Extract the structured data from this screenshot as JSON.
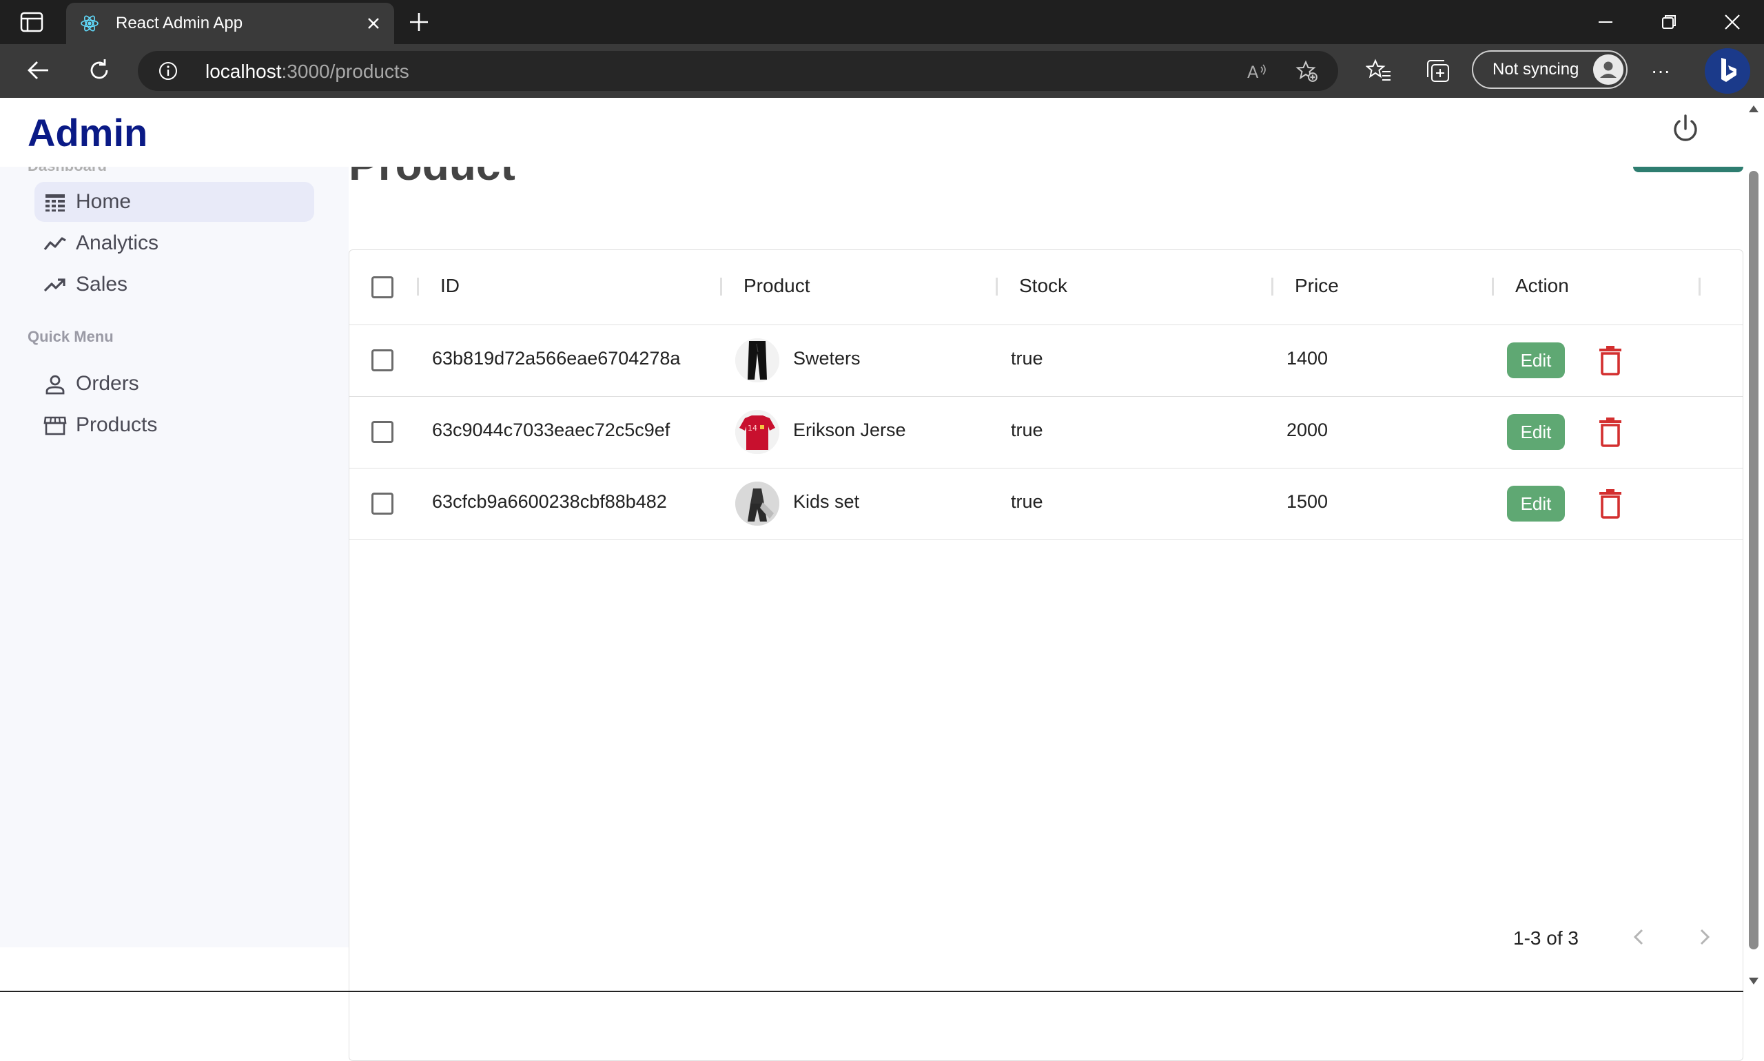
{
  "browser": {
    "tab_title": "React Admin App",
    "url_host": "localhost",
    "url_path": ":3000/products",
    "sync_label": "Not syncing",
    "more_label": "···"
  },
  "header": {
    "logo": "Admin"
  },
  "sidebar": {
    "section_dashboard": "Dashboard",
    "items": [
      {
        "label": "Home",
        "icon": "home-icon",
        "active": true
      },
      {
        "label": "Analytics",
        "icon": "timeline-icon",
        "active": false
      },
      {
        "label": "Sales",
        "icon": "trending-up-icon",
        "active": false
      }
    ],
    "section_quick": "Quick Menu",
    "quick_items": [
      {
        "label": "Orders",
        "icon": "person-icon"
      },
      {
        "label": "Products",
        "icon": "storefront-icon"
      }
    ]
  },
  "main": {
    "heading": "Product"
  },
  "table": {
    "columns": [
      "ID",
      "Product",
      "Stock",
      "Price",
      "Action"
    ],
    "rows": [
      {
        "id": "63b819d72a566eae6704278a",
        "product": "Sweters",
        "stock": "true",
        "price": "1400",
        "edit_label": "Edit"
      },
      {
        "id": "63c9044c7033eaec72c5c9ef",
        "product": "Erikson Jerse",
        "stock": "true",
        "price": "2000",
        "edit_label": "Edit"
      },
      {
        "id": "63cfcb9a6600238cbf88b482",
        "product": "Kids set",
        "stock": "true",
        "price": "1500",
        "edit_label": "Edit"
      }
    ]
  },
  "pagination": {
    "text": "1-3 of 3"
  },
  "colors": {
    "brand": "#0a1a86",
    "edit_button": "#5fa873",
    "delete_icon": "#d32f2f",
    "sidebar_bg": "#f7f8fc"
  }
}
